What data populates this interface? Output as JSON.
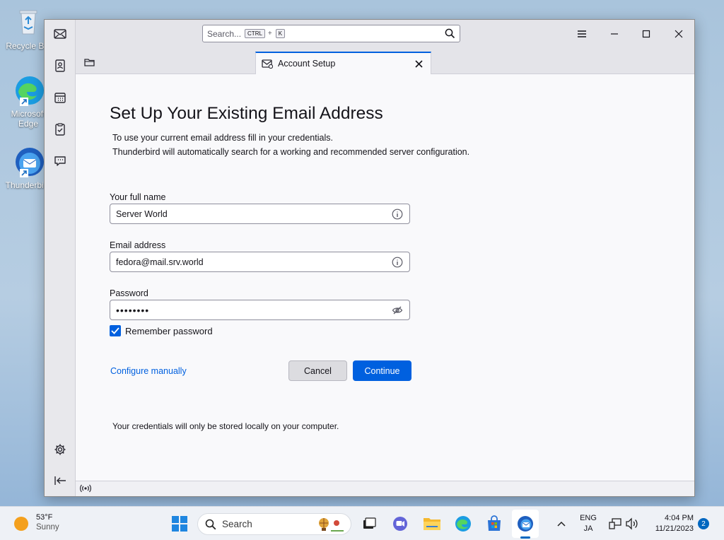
{
  "desktop": {
    "icons": [
      {
        "label": "Recycle Bin"
      },
      {
        "label": "Microsoft Edge"
      },
      {
        "label": "Thunderbird"
      }
    ]
  },
  "window": {
    "search": {
      "placeholder": "Search...",
      "key1": "CTRL",
      "plus": "+",
      "key2": "K"
    },
    "tab": {
      "label": "Account Setup"
    }
  },
  "setup": {
    "title": "Set Up Your Existing Email Address",
    "intro_line1": "To use your current email address fill in your credentials.",
    "intro_line2": "Thunderbird will automatically search for a working and recommended server configuration.",
    "fullname": {
      "label": "Your full name",
      "value": "Server World"
    },
    "email": {
      "label": "Email address",
      "value": "fedora@mail.srv.world"
    },
    "password": {
      "label": "Password",
      "value": "••••••••"
    },
    "remember": {
      "label": "Remember password",
      "checked": true
    },
    "configure_manually": "Configure manually",
    "cancel": "Cancel",
    "continue": "Continue",
    "note": "Your credentials will only be stored locally on your computer."
  },
  "taskbar": {
    "weather": {
      "temp": "53°F",
      "condition": "Sunny"
    },
    "search_label": "Search",
    "lang1": "ENG",
    "lang2": "JA",
    "time": "4:04 PM",
    "date": "11/21/2023",
    "notifications": "2"
  },
  "colors": {
    "accent": "#0060df",
    "taskbar_accent": "#0067c0"
  }
}
